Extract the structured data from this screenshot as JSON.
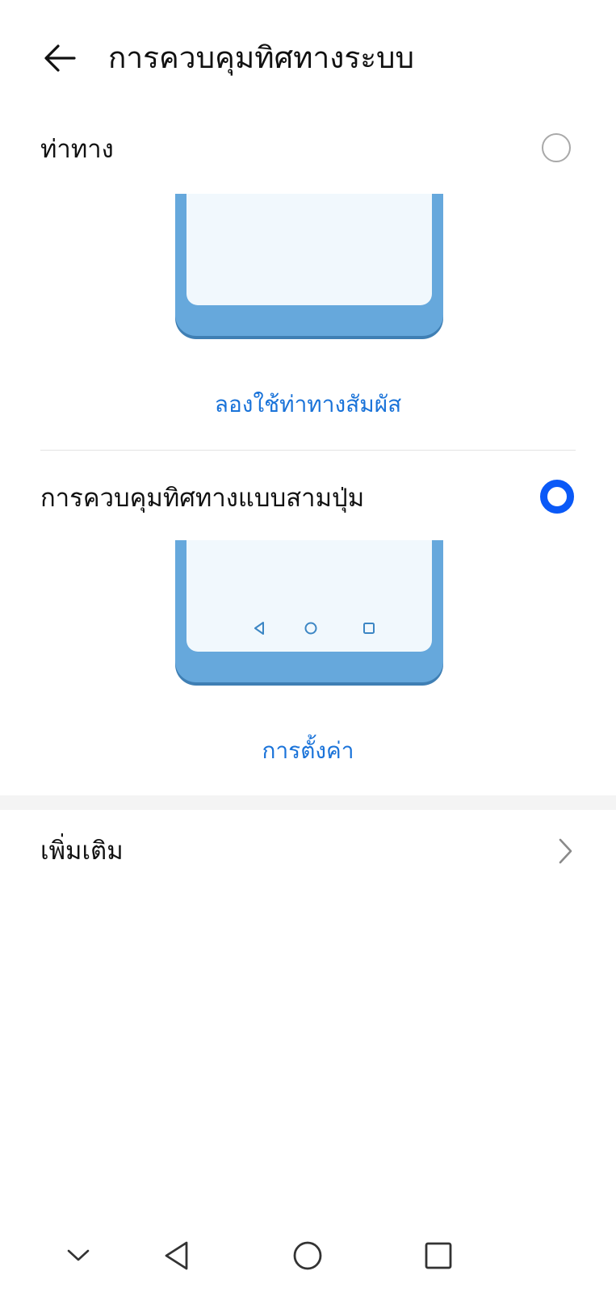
{
  "header": {
    "title": "การควบคุมทิศทางระบบ",
    "back_icon": "arrow-left-icon"
  },
  "options": [
    {
      "label": "ท่าทาง",
      "selected": false,
      "link_label": "ลองใช้ท่าทางสัมผัส"
    },
    {
      "label": "การควบคุมทิศทางแบบสามปุ่ม",
      "selected": true,
      "link_label": "การตั้งค่า"
    }
  ],
  "more": {
    "label": "เพิ่มเติม",
    "icon": "chevron-right-icon"
  },
  "system_nav": {
    "icons": [
      "chevron-down-icon",
      "back-triangle-icon",
      "home-circle-icon",
      "recents-square-icon"
    ]
  },
  "colors": {
    "accent": "#0a59f7",
    "link": "#1a73d9",
    "phone_frame": "#66a8dc",
    "phone_screen": "#f1f8fd"
  }
}
